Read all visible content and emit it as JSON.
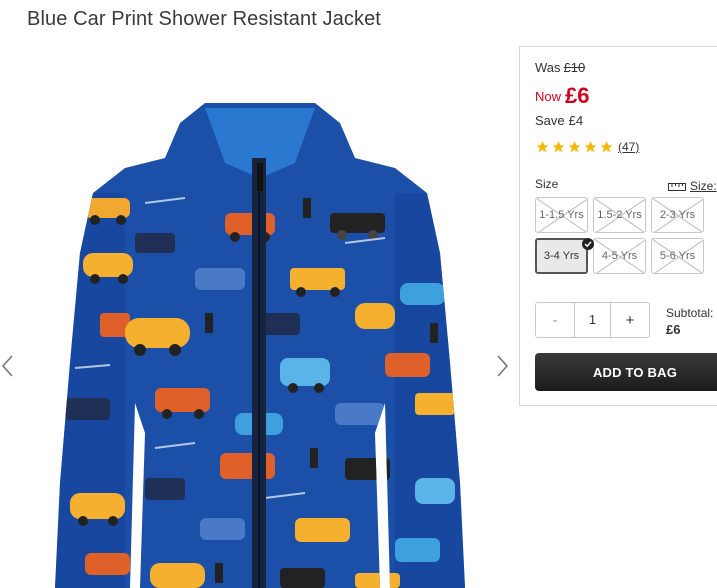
{
  "product": {
    "title": "Blue Car Print Shower Resistant Jacket"
  },
  "price": {
    "was_label": "Was",
    "was_value": "£10",
    "now_label": "Now",
    "now_value": "£6",
    "save_label": "Save",
    "save_value": "£4",
    "accent_color": "#d0021b"
  },
  "rating": {
    "stars": 5,
    "max": 5,
    "reviews_text": "(47)",
    "star_color": "#f5b800"
  },
  "size": {
    "label": "Size",
    "guide_label": "Size:",
    "options": [
      {
        "label": "1-1.5 Yrs",
        "available": false,
        "selected": false
      },
      {
        "label": "1.5-2 Yrs",
        "available": false,
        "selected": false
      },
      {
        "label": "2-3 Yrs",
        "available": false,
        "selected": false
      },
      {
        "label": "3-4 Yrs",
        "available": true,
        "selected": true
      },
      {
        "label": "4-5 Yrs",
        "available": false,
        "selected": false
      },
      {
        "label": "5-6 Yrs",
        "available": false,
        "selected": false
      }
    ]
  },
  "quantity": {
    "minus": "-",
    "value": "1",
    "plus": "+"
  },
  "subtotal": {
    "label": "Subtotal:",
    "value": "£6"
  },
  "cart": {
    "add_label": "ADD TO BAG"
  }
}
